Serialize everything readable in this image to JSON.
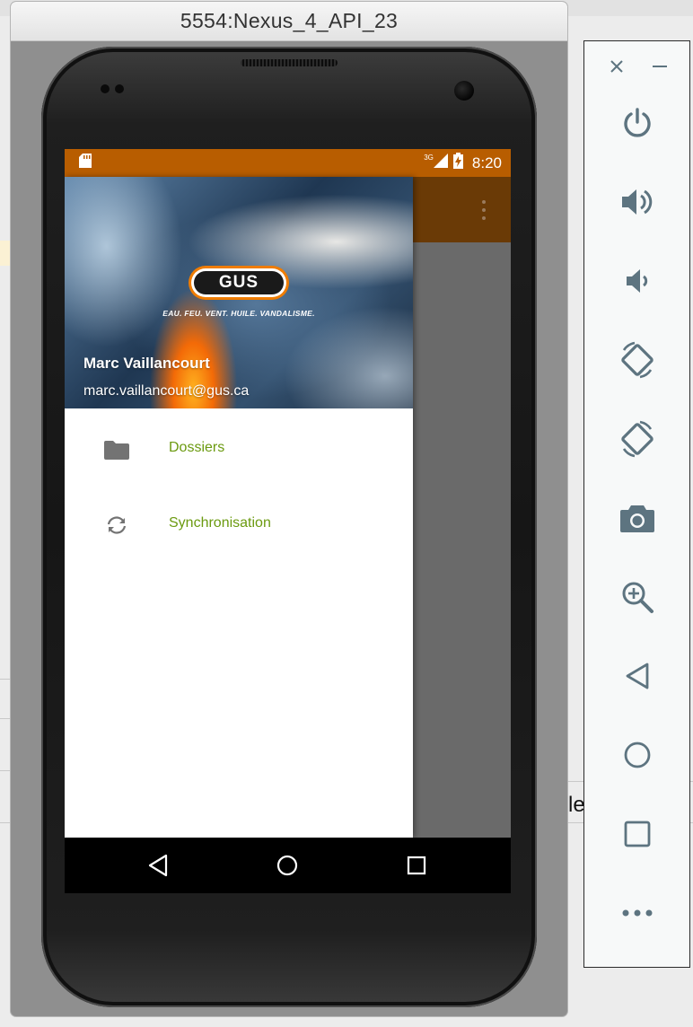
{
  "window": {
    "title": "5554:Nexus_4_API_23"
  },
  "status_bar": {
    "time": "8:20",
    "network_type": "3G",
    "icons": [
      "sd-card-icon",
      "signal-icon",
      "battery-charging-icon"
    ]
  },
  "drawer": {
    "header": {
      "logo_text": "GUS",
      "tagline": "EAU. FEU. VENT. HUILE. VANDALISME.",
      "user_name": "Marc Vaillancourt",
      "user_email": "marc.vaillancourt@gus.ca"
    },
    "items": [
      {
        "label": "Dossiers",
        "icon": "folder-icon"
      },
      {
        "label": "Synchronisation",
        "icon": "sync-icon"
      }
    ],
    "label_color": "#6b9a10"
  },
  "app": {
    "toolbar_color": "#6a3a06",
    "status_color": "#b85d00",
    "overflow_icon": "more-vertical-icon"
  },
  "nav_bar": {
    "buttons": [
      "back-icon",
      "home-icon",
      "recents-icon"
    ]
  },
  "emulator_panel": {
    "buttons": [
      "close-icon",
      "minimize-icon",
      "power-icon",
      "volume-up-icon",
      "volume-down-icon",
      "rotate-left-icon",
      "rotate-right-icon",
      "camera-icon",
      "zoom-icon",
      "back-icon",
      "home-icon",
      "overview-icon",
      "more-icon"
    ]
  },
  "background": {
    "partial_text": "le"
  }
}
